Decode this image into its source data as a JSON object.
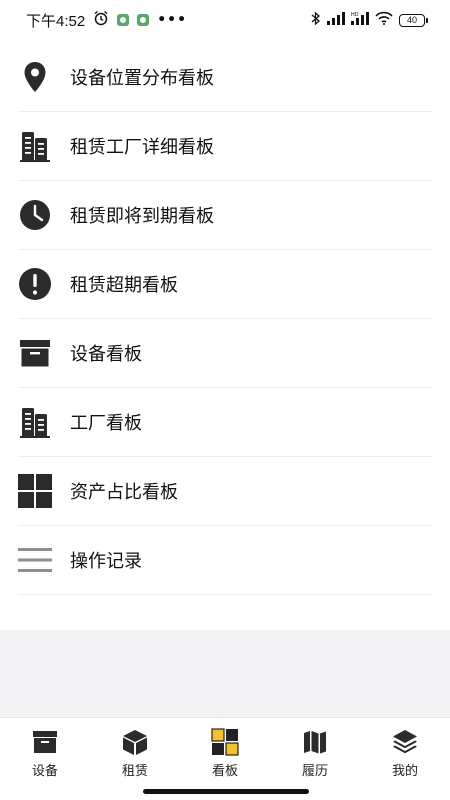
{
  "status_bar": {
    "time": "下午4:52",
    "more": "•••",
    "battery": "40",
    "icons": [
      "alarm-icon",
      "app-notification-icon",
      "bluetooth-icon",
      "signal-icon",
      "hd-signal-icon",
      "wifi-icon",
      "battery-icon"
    ]
  },
  "menu": {
    "items": [
      {
        "label": "设备位置分布看板",
        "icon": "location-pin-icon"
      },
      {
        "label": "租赁工厂详细看板",
        "icon": "building-icon"
      },
      {
        "label": "租赁即将到期看板",
        "icon": "clock-icon"
      },
      {
        "label": "租赁超期看板",
        "icon": "exclamation-icon"
      },
      {
        "label": "设备看板",
        "icon": "archive-box-icon"
      },
      {
        "label": "工厂看板",
        "icon": "building-icon"
      },
      {
        "label": "资产占比看板",
        "icon": "grid-icon"
      },
      {
        "label": "操作记录",
        "icon": "list-lines-icon"
      }
    ]
  },
  "bottom_nav": {
    "active": "看板",
    "accent_color": "#f2c12e",
    "items": [
      {
        "label": "设备",
        "icon": "archive-box-icon"
      },
      {
        "label": "租赁",
        "icon": "cube-icon"
      },
      {
        "label": "看板",
        "icon": "dashboard-grid-icon"
      },
      {
        "label": "履历",
        "icon": "map-book-icon"
      },
      {
        "label": "我的",
        "icon": "layers-icon"
      }
    ]
  }
}
